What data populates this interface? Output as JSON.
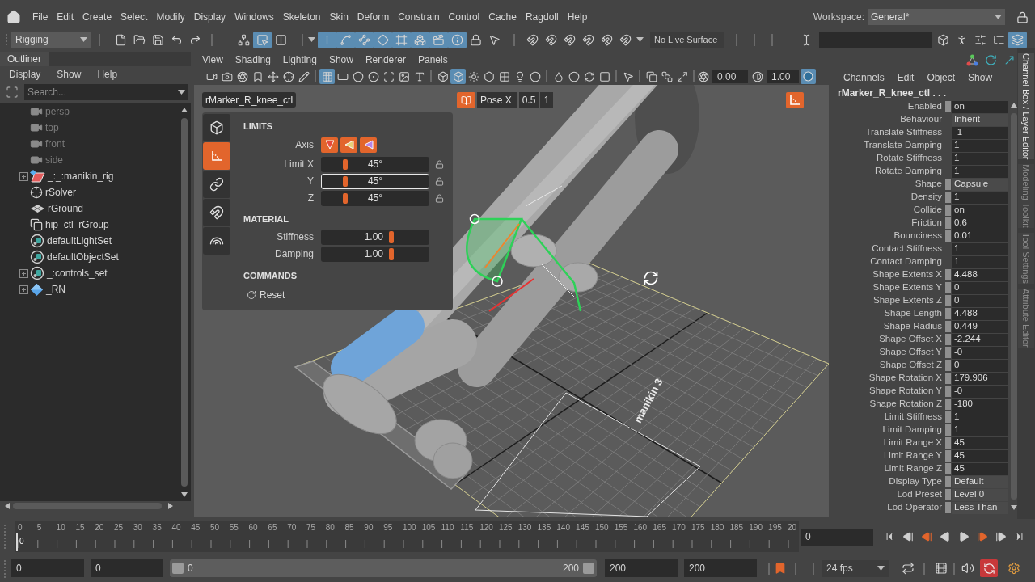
{
  "menu_bar": {
    "items": [
      "File",
      "Edit",
      "Create",
      "Select",
      "Modify",
      "Display",
      "Windows",
      "Skeleton",
      "Skin",
      "Deform",
      "Constrain",
      "Control",
      "Cache",
      "Ragdoll",
      "Help"
    ],
    "workspace_label": "Workspace:",
    "workspace": "General*"
  },
  "toolbar": {
    "mode": "Rigging",
    "file_tools": [
      {
        "on": false
      },
      {
        "on": false
      },
      {
        "on": false
      },
      {
        "on": false
      },
      {
        "on": false
      }
    ],
    "select_tools": [
      {
        "on": false
      },
      {
        "on": true
      },
      {
        "on": false
      }
    ],
    "snap_tools": [
      {
        "on": true
      },
      {
        "on": true
      },
      {
        "on": true
      },
      {
        "on": true
      },
      {
        "on": true
      },
      {
        "on": true
      },
      {
        "on": true
      },
      {
        "on": true
      },
      {
        "on": false
      },
      {
        "on": false
      }
    ],
    "live_tools": [
      {
        "on": false
      },
      {
        "on": false
      },
      {
        "on": false
      },
      {
        "on": false
      },
      {
        "on": false
      },
      {
        "on": false
      }
    ],
    "live_surface": "No Live Surface",
    "input_tools": [
      {
        "on": false
      }
    ],
    "panel_tools": [
      {
        "on": false
      },
      {
        "on": false
      },
      {
        "on": false
      },
      {
        "on": false
      },
      {
        "on": true
      }
    ]
  },
  "outliner": {
    "tab": "Outliner",
    "menu": [
      "Display",
      "Show",
      "Help"
    ],
    "search": {
      "placeholder": "Search..."
    },
    "items": [
      {
        "label": "persp",
        "kind": "camera",
        "dimmed": true,
        "expandable": false
      },
      {
        "label": "top",
        "kind": "camera",
        "dimmed": true,
        "expandable": false
      },
      {
        "label": "front",
        "kind": "camera",
        "dimmed": true,
        "expandable": false
      },
      {
        "label": "side",
        "kind": "camera",
        "dimmed": true,
        "expandable": false
      },
      {
        "label": "_:_:manikin_rig",
        "kind": "rig",
        "dimmed": false,
        "expandable": true
      },
      {
        "label": "rSolver",
        "kind": "solver",
        "dimmed": false,
        "expandable": false
      },
      {
        "label": "rGround",
        "kind": "ground",
        "dimmed": false,
        "expandable": false
      },
      {
        "label": "hip_ctl_rGroup",
        "kind": "group",
        "dimmed": false,
        "expandable": false
      },
      {
        "label": "defaultLightSet",
        "kind": "set",
        "dimmed": false,
        "expandable": false
      },
      {
        "label": "defaultObjectSet",
        "kind": "set",
        "dimmed": false,
        "expandable": false
      },
      {
        "label": "_:controls_set",
        "kind": "set",
        "dimmed": false,
        "expandable": true
      },
      {
        "label": "_RN",
        "kind": "reference",
        "dimmed": false,
        "expandable": true
      }
    ]
  },
  "viewport": {
    "menu": [
      "View",
      "Shading",
      "Lighting",
      "Show",
      "Renderer",
      "Panels"
    ],
    "toolbar": {
      "groups": [
        [
          {
            "on": false
          },
          {
            "on": false
          },
          {
            "on": false
          },
          {
            "on": false
          },
          {
            "on": false
          },
          {
            "on": false
          },
          {
            "on": false
          }
        ],
        [
          {
            "on": true
          },
          {
            "on": false
          },
          {
            "on": false
          },
          {
            "on": false
          },
          {
            "on": false
          },
          {
            "on": false
          },
          {
            "on": false
          }
        ],
        [
          {
            "on": false
          },
          {
            "on": true
          },
          {
            "on": false
          },
          {
            "on": false
          },
          {
            "on": false
          },
          {
            "on": false
          },
          {
            "on": false
          }
        ],
        [
          {
            "on": false
          },
          {
            "on": false
          },
          {
            "on": false
          },
          {
            "on": false
          }
        ],
        [
          {
            "on": false
          }
        ],
        [
          {
            "on": false
          },
          {
            "on": false
          },
          {
            "on": false
          }
        ]
      ],
      "exposure": "0.00",
      "gamma": "1.00",
      "color_management": {
        "on": true
      }
    },
    "selection": "rMarker_R_knee_ctl",
    "pose": {
      "label": "Pose X",
      "value": "0.5",
      "step": "1"
    },
    "floor_label": "manikin 3",
    "ragdoll_panel": {
      "tabs": [
        {
          "selected": false
        },
        {
          "selected": true
        },
        {
          "selected": false
        },
        {
          "selected": false
        },
        {
          "selected": false
        }
      ],
      "limits": {
        "title": "LIMITS",
        "axis_label": "Axis",
        "axes": [
          {
            "color": "#e84b3c"
          },
          {
            "color": "#e8d17a"
          },
          {
            "color": "#b784e6"
          }
        ],
        "rows": [
          {
            "label": "Limit X",
            "value": "45°",
            "level": 0.22,
            "focused": false
          },
          {
            "label": "Y",
            "value": "45°",
            "level": 0.22,
            "focused": true
          },
          {
            "label": "Z",
            "value": "45°",
            "level": 0.22,
            "focused": false
          }
        ]
      },
      "material": {
        "title": "MATERIAL",
        "rows": [
          {
            "label": "Stiffness",
            "value": "1.00",
            "level": 0.65
          },
          {
            "label": "Damping",
            "value": "1.00",
            "level": 0.65
          }
        ]
      },
      "commands": {
        "title": "COMMANDS",
        "buttons": [
          "Reset"
        ]
      }
    }
  },
  "channel_box": {
    "menu": [
      "Channels",
      "Edit",
      "Object",
      "Show"
    ],
    "object": "rMarker_R_knee_ctl . . .",
    "rows": [
      {
        "label": "Enabled",
        "value": "on",
        "kind": "field",
        "keyable": true
      },
      {
        "label": "Behaviour",
        "value": "Inherit",
        "kind": "enum",
        "keyable": false
      },
      {
        "label": "Translate Stiffness",
        "value": "-1",
        "kind": "field",
        "keyable": false
      },
      {
        "label": "Translate Damping",
        "value": "1",
        "kind": "field",
        "keyable": false
      },
      {
        "label": "Rotate Stiffness",
        "value": "1",
        "kind": "field",
        "keyable": false
      },
      {
        "label": "Rotate Damping",
        "value": "1",
        "kind": "field",
        "keyable": false
      },
      {
        "label": "Shape",
        "value": "Capsule",
        "kind": "enum",
        "keyable": true
      },
      {
        "label": "Density",
        "value": "1",
        "kind": "field",
        "keyable": true
      },
      {
        "label": "Collide",
        "value": "on",
        "kind": "field",
        "keyable": true
      },
      {
        "label": "Friction",
        "value": "0.6",
        "kind": "field",
        "keyable": true
      },
      {
        "label": "Bounciness",
        "value": "0.01",
        "kind": "field",
        "keyable": true
      },
      {
        "label": "Contact Stiffness",
        "value": "1",
        "kind": "field",
        "keyable": false
      },
      {
        "label": "Contact Damping",
        "value": "1",
        "kind": "field",
        "keyable": false
      },
      {
        "label": "Shape Extents X",
        "value": "4.488",
        "kind": "field",
        "keyable": true
      },
      {
        "label": "Shape Extents Y",
        "value": "0",
        "kind": "field",
        "keyable": true
      },
      {
        "label": "Shape Extents Z",
        "value": "0",
        "kind": "field",
        "keyable": true
      },
      {
        "label": "Shape Length",
        "value": "4.488",
        "kind": "field",
        "keyable": true
      },
      {
        "label": "Shape Radius",
        "value": "0.449",
        "kind": "field",
        "keyable": true
      },
      {
        "label": "Shape Offset X",
        "value": "-2.244",
        "kind": "field",
        "keyable": true
      },
      {
        "label": "Shape Offset Y",
        "value": "-0",
        "kind": "field",
        "keyable": true
      },
      {
        "label": "Shape Offset Z",
        "value": "0",
        "kind": "field",
        "keyable": true
      },
      {
        "label": "Shape Rotation X",
        "value": "179.906",
        "kind": "field",
        "keyable": true
      },
      {
        "label": "Shape Rotation Y",
        "value": "-0",
        "kind": "field",
        "keyable": true
      },
      {
        "label": "Shape Rotation Z",
        "value": "-180",
        "kind": "field",
        "keyable": true
      },
      {
        "label": "Limit Stiffness",
        "value": "1",
        "kind": "field",
        "keyable": true
      },
      {
        "label": "Limit Damping",
        "value": "1",
        "kind": "field",
        "keyable": true
      },
      {
        "label": "Limit Range X",
        "value": "45",
        "kind": "field",
        "keyable": true
      },
      {
        "label": "Limit Range Y",
        "value": "45",
        "kind": "field",
        "keyable": true
      },
      {
        "label": "Limit Range Z",
        "value": "45",
        "kind": "field",
        "keyable": true
      },
      {
        "label": "Display Type",
        "value": "Default",
        "kind": "enum",
        "keyable": true
      },
      {
        "label": "Lod Preset",
        "value": "Level 0",
        "kind": "enum",
        "keyable": true
      },
      {
        "label": "Lod Operator",
        "value": "Less Than",
        "kind": "enum",
        "keyable": true
      }
    ],
    "side_tabs": [
      {
        "label": "Channel Box / Layer Editor",
        "selected": true
      },
      {
        "label": "Modeling Toolkit",
        "selected": false
      },
      {
        "label": "Tool Settings",
        "selected": false
      },
      {
        "label": "Attribute Editor",
        "selected": false
      }
    ]
  },
  "timeline": {
    "ticks": [
      "0",
      "5",
      "10",
      "15",
      "20",
      "25",
      "30",
      "35",
      "40",
      "45",
      "50",
      "55",
      "60",
      "65",
      "70",
      "75",
      "80",
      "85",
      "90",
      "95",
      "100",
      "105",
      "110",
      "115",
      "120",
      "125",
      "130",
      "135",
      "140",
      "145",
      "150",
      "155",
      "160",
      "165",
      "170",
      "175",
      "180",
      "185",
      "190",
      "195",
      "20"
    ],
    "level": 0,
    "current_frame": "0",
    "frame_field": "0"
  },
  "range": {
    "start": "0",
    "playback_start": "0",
    "slider": {
      "start": "0",
      "end": "200",
      "level": 1
    },
    "playback_end": "200",
    "end": "200",
    "fps": "24 fps",
    "auto_key": {
      "on": true
    }
  }
}
